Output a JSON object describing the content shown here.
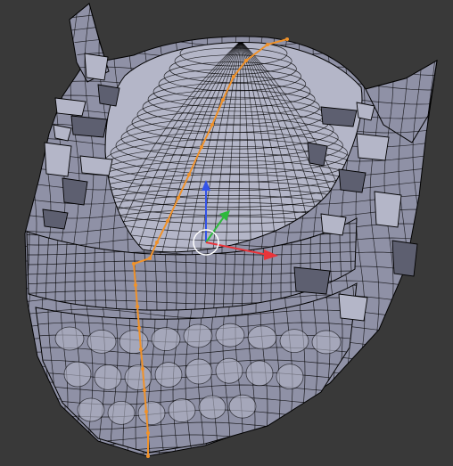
{
  "viewport": {
    "background_color": "#393939",
    "mesh_fill_color": "#8f91a6",
    "mesh_shadow_color": "#5d5f70",
    "mesh_highlight_color": "#b4b6c8",
    "wire_color": "#000000",
    "selected_edge_color": "#f0922a"
  },
  "manipulator": {
    "x_axis_color": "#e8343a",
    "y_axis_color": "#2db93c",
    "z_axis_color": "#3353e8",
    "pivot_color": "#ffffff"
  }
}
